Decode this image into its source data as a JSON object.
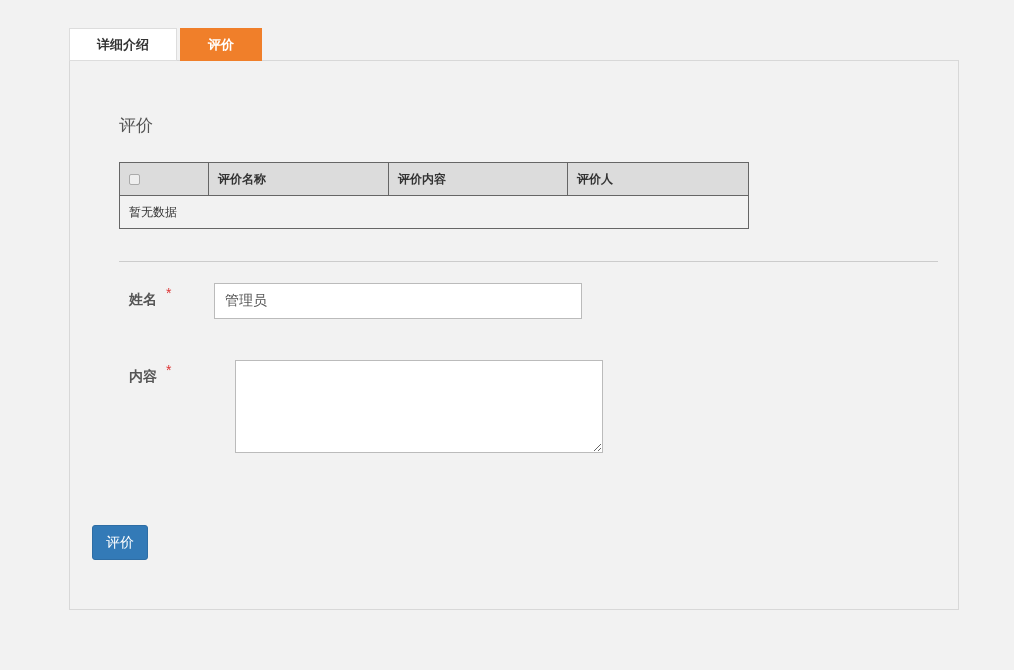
{
  "tabs": [
    {
      "label": "详细介绍",
      "selected": false
    },
    {
      "label": "评价",
      "selected": true
    }
  ],
  "section_title": "评价",
  "table": {
    "select_all_checked": false,
    "columns": [
      "评价名称",
      "评价内容",
      "评价人"
    ],
    "empty_text": "暂无数据"
  },
  "fields": [
    {
      "kind": "input",
      "label": "姓名",
      "required_mark": "*",
      "value": "管理员"
    },
    {
      "kind": "textarea",
      "label": "内容",
      "required_mark": "*"
    }
  ],
  "submit_button": "评价"
}
